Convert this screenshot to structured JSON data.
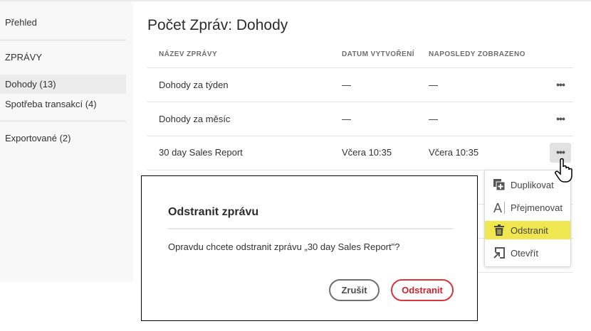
{
  "sidebar": {
    "overview": "Přehled",
    "section": "ZPRÁVY",
    "items": [
      {
        "label": "Dohody (13)"
      },
      {
        "label": "Spotřeba transakcí (4)"
      }
    ],
    "exported": "Exportované (2)"
  },
  "page": {
    "title": "Počet Zpráv: Dohody"
  },
  "table": {
    "headers": [
      "NÁZEV ZPRÁVY",
      "DATUM VYTVOŘENÍ",
      "NAPOSLEDY ZOBRAZENO"
    ],
    "rows": [
      {
        "name": "Dohody za týden",
        "created": "—",
        "viewed": "—"
      },
      {
        "name": "Dohody za měsíc",
        "created": "—",
        "viewed": "—"
      },
      {
        "name": "30 day Sales Report",
        "created": "Včera 10:35",
        "viewed": "Včera 10:35"
      }
    ],
    "more": "•••"
  },
  "menu": {
    "items": [
      "Duplikovat",
      "Přejmenovat",
      "Odstranit",
      "Otevřít"
    ],
    "highlight_color": "#f0e650"
  },
  "dialog": {
    "title": "Odstranit zprávu",
    "body": "Opravdu chcete odstranit zprávu „30 day Sales Report\"?",
    "cancel": "Zrušit",
    "confirm": "Odstranit",
    "accent": "#d7373f"
  }
}
